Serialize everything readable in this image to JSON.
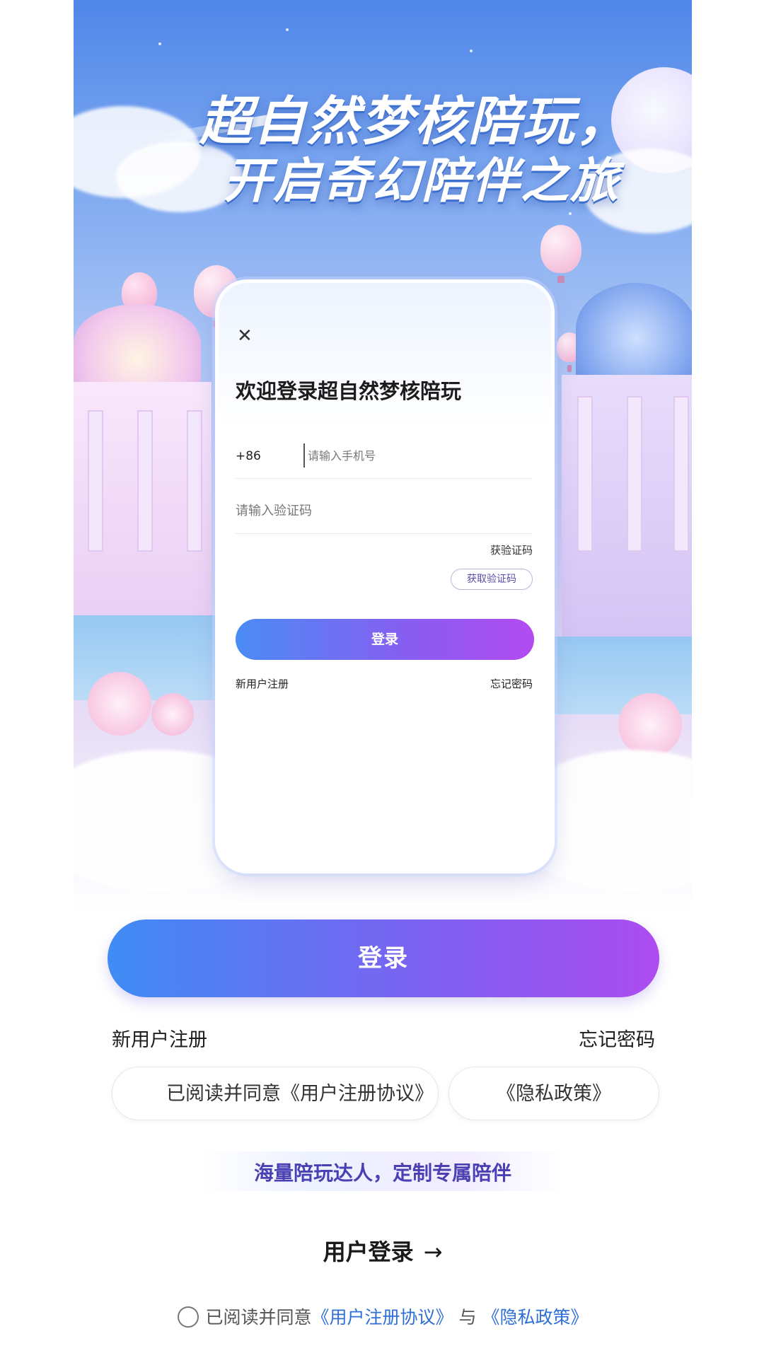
{
  "hero": {
    "title_line1": "超自然梦核陪玩，",
    "title_line2": "开启奇幻陪伴之旅"
  },
  "phone_screen": {
    "close_icon": "close-icon",
    "welcome": "欢迎登录超自然梦核陪玩",
    "country_code": "+86",
    "phone_placeholder": "请输入手机号",
    "code_placeholder": "请输入验证码",
    "get_code_text": "获验证码",
    "get_code_button": "获取验证码",
    "login_button": "登录",
    "register_link": "新用户注册",
    "forgot_link": "忘记密码"
  },
  "main": {
    "login_button": "登录",
    "register_link": "新用户注册",
    "forgot_link": "忘记密码",
    "agreement_pill": "已阅读并同意《用户注册协议》",
    "privacy_pill": "《隐私政策》",
    "slogan": "海量陪玩达人，定制专属陪伴",
    "user_login": "用户登录",
    "user_login_arrow": "→"
  },
  "consent": {
    "prefix": "已阅读并同意",
    "user_agreement": "《用户注册协议》",
    "conjunction": "与",
    "privacy_policy": "《隐私政策》"
  },
  "colors": {
    "accent_start": "#3f8cf4",
    "accent_end": "#ad4cf1",
    "link": "#2f6fd6",
    "slogan": "#4a3fb3"
  }
}
